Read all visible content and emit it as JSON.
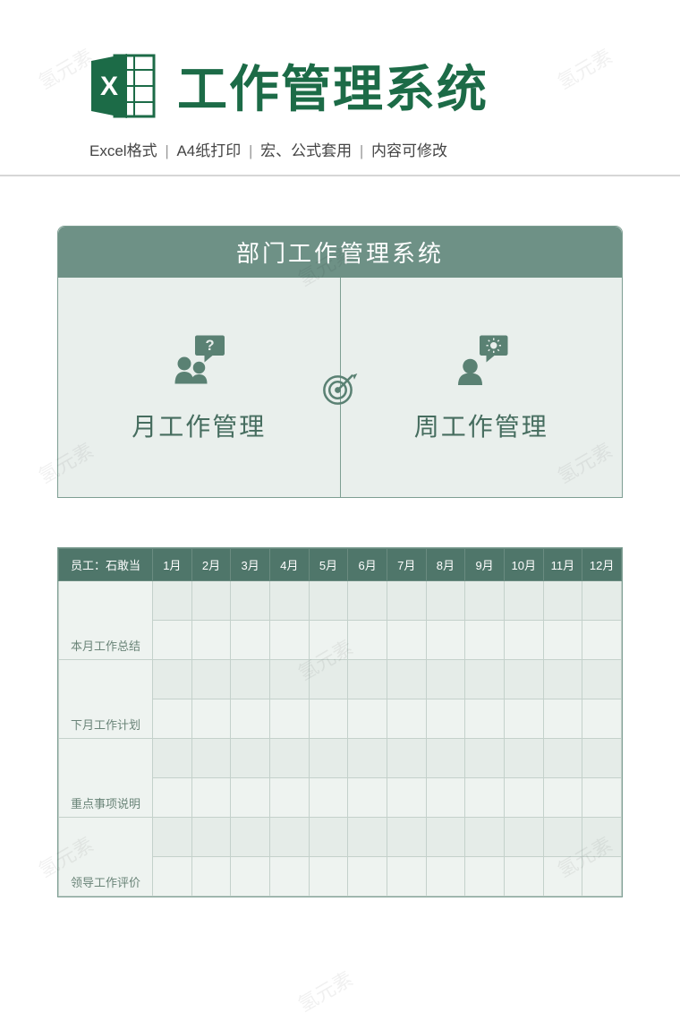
{
  "header": {
    "title": "工作管理系统",
    "icon_letter": "X",
    "subtitle_parts": [
      "Excel格式",
      "A4纸打印",
      "宏、公式套用",
      "内容可修改"
    ]
  },
  "card": {
    "title": "部门工作管理系统",
    "left_icon": "people-question-icon",
    "left_label": "月工作管理",
    "center_icon": "target-icon",
    "right_icon": "person-idea-icon",
    "right_label": "周工作管理"
  },
  "table": {
    "employee_header": "员工：石敢当",
    "months": [
      "1月",
      "2月",
      "3月",
      "4月",
      "5月",
      "6月",
      "7月",
      "8月",
      "9月",
      "10月",
      "11月",
      "12月"
    ],
    "row_labels": [
      "本月工作总结",
      "下月工作计划",
      "重点事项说明",
      "领导工作评价"
    ]
  },
  "watermark_text": "氢元素"
}
